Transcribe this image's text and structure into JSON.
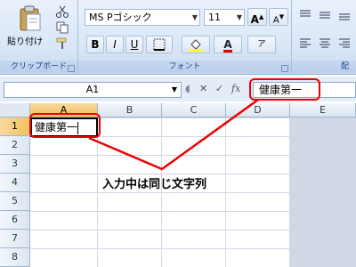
{
  "ribbon": {
    "clipboard": {
      "paste_label": "貼り付け",
      "group_label": "クリップボード",
      "icons": [
        "paste-icon",
        "cut-icon",
        "copy-icon",
        "format-painter-icon"
      ]
    },
    "font": {
      "font_name": "MS Pゴシック",
      "font_size": "11",
      "group_label": "フォント",
      "buttons": {
        "bold": "B",
        "italic": "I",
        "underline": "U",
        "grow": "A",
        "shrink": "A",
        "phonetic": "ア"
      }
    },
    "alignment": {
      "group_label": "配"
    }
  },
  "formula_bar": {
    "name_box": "A1",
    "formula_value": "健康第一",
    "buttons": [
      "cancel-icon",
      "enter-icon",
      "fx"
    ],
    "fx_label": "fx"
  },
  "grid": {
    "columns": [
      "A",
      "B",
      "C",
      "D",
      "E"
    ],
    "rows": [
      "1",
      "2",
      "3",
      "4",
      "5",
      "6",
      "7",
      "8"
    ],
    "active_cell": "A1",
    "cell_A1": "健康第一"
  },
  "annotation": {
    "text": "入力中は同じ文字列",
    "color": "#ee0000"
  }
}
